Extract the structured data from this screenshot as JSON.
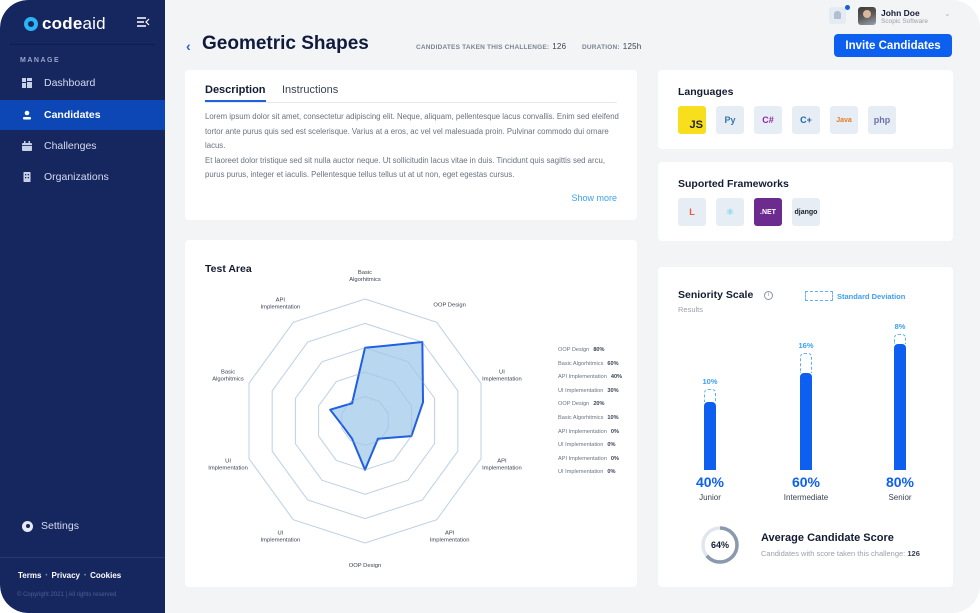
{
  "sidebar": {
    "logo": {
      "bold": "code",
      "light": "aid"
    },
    "section": "MANAGE",
    "items": [
      {
        "label": "Dashboard",
        "icon": "dashboard-icon",
        "active": false
      },
      {
        "label": "Candidates",
        "icon": "user-icon",
        "active": true
      },
      {
        "label": "Challenges",
        "icon": "calendar-icon",
        "active": false
      },
      {
        "label": "Organizations",
        "icon": "building-icon",
        "active": false
      }
    ],
    "settings": "Settings",
    "footer_links": [
      "Terms",
      "Privacy",
      "Cookies"
    ],
    "copyright": "© Copyright 2021 | All rights reserved"
  },
  "header": {
    "title": "Geometric Shapes",
    "candidates_label": "CANDIDATES TAKEN THIS CHALLENGE:",
    "candidates_value": "126",
    "duration_label": "DURATION:",
    "duration_value": "125h",
    "invite_label": "Invite Candidates",
    "user_name": "John Doe",
    "user_company": "Scopic Software"
  },
  "description": {
    "tabs": [
      "Description",
      "Instructions"
    ],
    "active_tab": "Description",
    "paragraph1": "Lorem ipsum dolor sit amet, consectetur adipiscing elit. Neque, aliquam, pellentesque lacus convallis. Enim sed eleifend tortor ante purus quis sed est scelerisque. Varius at a eros, ac vel vel malesuada proin. Pulvinar commodo dui ornare lacus.",
    "paragraph2": "Et laoreet dolor tristique sed sit nulla auctor neque. Ut sollicitudin lacus vitae in duis. Tincidunt quis sagittis sed arcu, purus purus, integer et iaculis. Pellentesque tellus tellus ut at ut non, eget egestas cursus.",
    "show_more": "Show more"
  },
  "languages": {
    "title": "Languages",
    "items": [
      {
        "name": "JavaScript",
        "glyph": "JS",
        "bg": "#f7df1e",
        "color": "#222222"
      },
      {
        "name": "Python",
        "glyph": "Py",
        "bg": "#e7edf5",
        "color": "#3776ab"
      },
      {
        "name": "C#",
        "glyph": "C#",
        "bg": "#e7edf5",
        "color": "#8a2aa3"
      },
      {
        "name": "C++",
        "glyph": "C+",
        "bg": "#e7edf5",
        "color": "#1f63b0"
      },
      {
        "name": "Java",
        "glyph": "Java",
        "bg": "#e7edf5",
        "color": "#e87a20"
      },
      {
        "name": "PHP",
        "glyph": "php",
        "bg": "#e7edf5",
        "color": "#6b70a8"
      }
    ]
  },
  "frameworks": {
    "title": "Suported Frameworks",
    "items": [
      {
        "name": "Laravel",
        "glyph": "L",
        "bg": "#e7edf5",
        "color": "#f05340"
      },
      {
        "name": "React",
        "glyph": "⚛",
        "bg": "#e7edf5",
        "color": "#35c6f0"
      },
      {
        "name": ".NET",
        "glyph": ".NET",
        "bg": "#6c2b8f",
        "color": "#ffffff"
      },
      {
        "name": "Django",
        "glyph": "django",
        "bg": "#e7edf5",
        "color": "#1b1f23"
      }
    ]
  },
  "test_area": {
    "title": "Test Area",
    "chart_data": {
      "type": "radar",
      "axes": [
        "Basic Algorhitmics",
        "OOP Design",
        "UI Implementation",
        "API Implementation",
        "API Implementation",
        "OOP Design",
        "UI Implementation",
        "UI Implementation",
        "Basic Algorhitmics",
        "API Implementation"
      ],
      "values": [
        60,
        80,
        50,
        40,
        0,
        40,
        0,
        10,
        30,
        10
      ],
      "range": [
        0,
        100
      ],
      "rings": 5,
      "legend": [
        {
          "label": "OOP Design",
          "value": "80%"
        },
        {
          "label": "Basic Algorhitmics",
          "value": "60%"
        },
        {
          "label": "API Implementation",
          "value": "40%"
        },
        {
          "label": "UI Implementation",
          "value": "30%"
        },
        {
          "label": "OOP Design",
          "value": "20%"
        },
        {
          "label": "Basic Algorhitmics",
          "value": "10%"
        },
        {
          "label": "API Implementation",
          "value": "0%"
        },
        {
          "label": "UI Implementation",
          "value": "0%"
        },
        {
          "label": "API Implementation",
          "value": "0%"
        },
        {
          "label": "UI Implementation",
          "value": "0%"
        }
      ],
      "colors": {
        "fill": "#b3d3ee",
        "stroke": "#1f5fe0",
        "grid": "#d8e2ec"
      }
    }
  },
  "seniority": {
    "title": "Seniority Scale",
    "subtitle": "Results",
    "legend": "Standard Deviation",
    "chart_data": {
      "type": "bar",
      "categories": [
        "Junior",
        "Intermediate",
        "Senior"
      ],
      "values": [
        40,
        60,
        80
      ],
      "value_labels": [
        "40%",
        "60%",
        "80%"
      ],
      "std_dev": [
        10,
        16,
        8
      ],
      "std_dev_labels": [
        "10%",
        "16%",
        "8%"
      ]
    },
    "avg_score": {
      "value": 64,
      "label": "64%",
      "title": "Average Candidate Score",
      "sub": "Candidates with score taken this challenge:",
      "count": "126"
    }
  }
}
